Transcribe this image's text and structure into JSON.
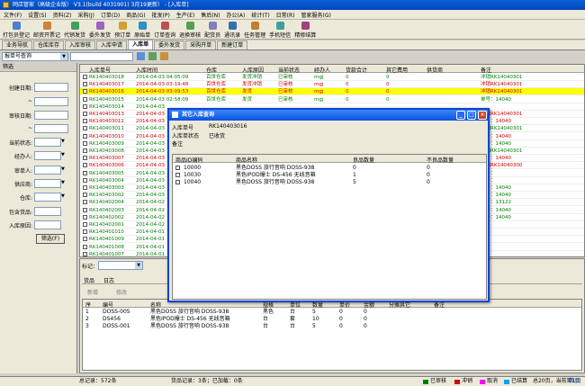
{
  "window": {
    "title": "网店管家（高级企业版） V3.1(build 4031901) 3月19更新） - [入库单]"
  },
  "menu": [
    "文件(F)",
    "设置(S)",
    "资料(Z)",
    "采购(J)",
    "订单(D)",
    "商品(G)",
    "批发(P)",
    "生产(E)",
    "售后(N)",
    "办公(A)",
    "统计(T)",
    "日常(R)",
    "管家服务(G)"
  ],
  "toolbar": [
    "打包员登记",
    "邮资开票记",
    "代销发货",
    "委外发货",
    "预订单",
    "原始单",
    "订单查询",
    "退换审核",
    "配货员",
    "通讯录",
    "任务管理",
    "手机短信",
    "精修结算"
  ],
  "tabs": [
    {
      "label": "业务导航",
      "active": false
    },
    {
      "label": "仓库库存",
      "active": false
    },
    {
      "label": "入库审核",
      "active": false
    },
    {
      "label": "入库申请",
      "active": false
    },
    {
      "label": "入库单",
      "active": true
    },
    {
      "label": "委外发货",
      "active": false
    },
    {
      "label": "采购开单",
      "active": false
    },
    {
      "label": "新建订单",
      "active": false
    }
  ],
  "top_controls": {
    "query_combo": "报单号查询"
  },
  "filter": {
    "header": "筛选",
    "labels": [
      "创建日期:",
      "~",
      "审核日期:",
      "~",
      "当前状态:",
      "经办人:",
      "审单人:",
      "供应商:",
      "仓库:",
      "包含货品:",
      "入库原因:"
    ],
    "button": "筛选(F)"
  },
  "grid": {
    "columns": [
      "入库单号",
      "入库时间",
      "仓库",
      "入库原因",
      "当前状态",
      "经办人",
      "货款合计",
      "其它费用",
      "供货商",
      "备注"
    ],
    "rows": [
      {
        "no": "RK140403018",
        "time": "2014-04-03 04:05:09",
        "wh": "百世仓库",
        "reason": "发货冲销",
        "status": "已审核",
        "op": "mgj",
        "amt": "0",
        "fee": "0",
        "note": "冲销RK14040301",
        "color": "#008000",
        "bg": ""
      },
      {
        "no": "RK140403017",
        "time": "2014-04-03 03:19:48",
        "wh": "百世仓库",
        "reason": "发货冲销",
        "status": "已审核",
        "op": "mgj",
        "amt": "0",
        "fee": "0",
        "note": "冲销RK14040301",
        "color": "#d00000",
        "bg": ""
      },
      {
        "no": "RK140403016",
        "time": "2014-04-03 03:09:53",
        "wh": "百世仓库",
        "reason": "发货",
        "status": "已审核",
        "op": "mgj",
        "amt": "0",
        "fee": "0",
        "note": "冲销RK14040301",
        "color": "#d00000",
        "bg": "#ffff00"
      },
      {
        "no": "RK140403015",
        "time": "2014-04-03 02:58:09",
        "wh": "百世仓库",
        "reason": "发货",
        "status": "已审核",
        "op": "mgj",
        "amt": "0",
        "fee": "0",
        "note": "单号：14040",
        "color": "#008000",
        "bg": ""
      },
      {
        "no": "RK140403014",
        "time": "2014-04-03",
        "wh": "",
        "reason": "",
        "status": "",
        "op": "",
        "amt": "",
        "fee": "",
        "note": "",
        "color": "#008000",
        "bg": ""
      },
      {
        "no": "RK140403013",
        "time": "2014-04-03",
        "wh": "",
        "reason": "",
        "status": "",
        "op": "",
        "amt": "",
        "fee": "",
        "note": "冲销RK14040301",
        "color": "#d00000",
        "bg": ""
      },
      {
        "no": "RK140403012",
        "time": "2014-04-03",
        "wh": "",
        "reason": "",
        "status": "",
        "op": "",
        "amt": "",
        "fee": "",
        "note": "单号：14040",
        "color": "#d00000",
        "bg": ""
      },
      {
        "no": "RK140403011",
        "time": "2014-04-03",
        "wh": "",
        "reason": "",
        "status": "",
        "op": "",
        "amt": "",
        "fee": "",
        "note": "冲销RK14040301",
        "color": "#008000",
        "bg": ""
      },
      {
        "no": "RK140403010",
        "time": "2014-04-03",
        "wh": "",
        "reason": "",
        "status": "",
        "op": "",
        "amt": "",
        "fee": "",
        "note": "单号：14040",
        "color": "#d00000",
        "bg": ""
      },
      {
        "no": "RK140403009",
        "time": "2014-04-03",
        "wh": "",
        "reason": "",
        "status": "",
        "op": "",
        "amt": "",
        "fee": "",
        "note": "单号：14040",
        "color": "#008000",
        "bg": ""
      },
      {
        "no": "RK140403008",
        "time": "2014-04-03",
        "wh": "",
        "reason": "",
        "status": "",
        "op": "",
        "amt": "",
        "fee": "",
        "note": "冲销RK14040301",
        "color": "#008000",
        "bg": ""
      },
      {
        "no": "RK140403007",
        "time": "2014-04-03",
        "wh": "",
        "reason": "",
        "status": "",
        "op": "",
        "amt": "",
        "fee": "",
        "note": "单号：14040",
        "color": "#d00000",
        "bg": ""
      },
      {
        "no": "RK140403006",
        "time": "2014-04-03",
        "wh": "",
        "reason": "",
        "status": "",
        "op": "",
        "amt": "",
        "fee": "",
        "note": "冲销RK14040300",
        "color": "#d00000",
        "bg": ""
      },
      {
        "no": "RK140403005",
        "time": "2014-04-03",
        "wh": "",
        "reason": "",
        "status": "",
        "op": "",
        "amt": "",
        "fee": "",
        "note": "单号：",
        "color": "#008000",
        "bg": ""
      },
      {
        "no": "RK140403004",
        "time": "2014-04-03",
        "wh": "",
        "reason": "",
        "status": "",
        "op": "",
        "amt": "",
        "fee": "",
        "note": "单号：",
        "color": "#008000",
        "bg": ""
      },
      {
        "no": "RK140403003",
        "time": "2014-04-03",
        "wh": "",
        "reason": "",
        "status": "",
        "op": "",
        "amt": "",
        "fee": "",
        "note": "单号：14040",
        "color": "#008000",
        "bg": ""
      },
      {
        "no": "RK140403002",
        "time": "2014-04-03",
        "wh": "",
        "reason": "",
        "status": "",
        "op": "",
        "amt": "",
        "fee": "",
        "note": "单号：14040",
        "color": "#008000",
        "bg": ""
      },
      {
        "no": "RK140402004",
        "time": "2014-04-02",
        "wh": "",
        "reason": "",
        "status": "",
        "op": "",
        "amt": "",
        "fee": "",
        "note": "单号：13122",
        "color": "#008000",
        "bg": ""
      },
      {
        "no": "RK140402003",
        "time": "2014-04-02",
        "wh": "",
        "reason": "",
        "status": "",
        "op": "",
        "amt": "",
        "fee": "",
        "note": "单号：14040",
        "color": "#008000",
        "bg": ""
      },
      {
        "no": "RK140402002",
        "time": "2014-04-02",
        "wh": "",
        "reason": "",
        "status": "",
        "op": "",
        "amt": "",
        "fee": "",
        "note": "单号：14040",
        "color": "#008000",
        "bg": ""
      },
      {
        "no": "RK140402001",
        "time": "2014-04-02",
        "wh": "",
        "reason": "",
        "status": "",
        "op": "",
        "amt": "",
        "fee": "",
        "note": "",
        "color": "#008000",
        "bg": ""
      },
      {
        "no": "RK140401010",
        "time": "2014-04-01",
        "wh": "",
        "reason": "",
        "status": "",
        "op": "",
        "amt": "",
        "fee": "",
        "note": "",
        "color": "#008000",
        "bg": ""
      },
      {
        "no": "RK140401009",
        "time": "2014-04-01",
        "wh": "",
        "reason": "",
        "status": "",
        "op": "",
        "amt": "",
        "fee": "",
        "note": "",
        "color": "#008000",
        "bg": ""
      },
      {
        "no": "RK140401008",
        "time": "2014-04-01",
        "wh": "",
        "reason": "",
        "status": "",
        "op": "",
        "amt": "",
        "fee": "",
        "note": "",
        "color": "#008000",
        "bg": ""
      },
      {
        "no": "RK140401007",
        "time": "2014-04-01",
        "wh": "",
        "reason": "",
        "status": "",
        "op": "",
        "amt": "",
        "fee": "",
        "note": "",
        "color": "#008000",
        "bg": ""
      }
    ]
  },
  "bottom": {
    "tag_label": "标记：",
    "tabs": [
      "货品",
      "日志"
    ],
    "buttons": [
      "新增",
      "修改"
    ],
    "columns": [
      "序",
      "编号",
      "名称",
      "规格",
      "单位",
      "数量",
      "单价",
      "金额",
      "分摊其它",
      "备注"
    ],
    "rows": [
      {
        "seq": "1",
        "code": "DOSS-005",
        "name": "黑色DOSS 旅行音响 DOSS-938",
        "spec": "黑色",
        "unit": "台",
        "qty": "5",
        "price": "0",
        "amt": "0"
      },
      {
        "seq": "2",
        "code": "DS456",
        "name": "黑色IPOD爆士 DS-456 无线音箱",
        "spec": "台",
        "unit": "套",
        "qty": "10",
        "price": "0",
        "amt": "0"
      },
      {
        "seq": "3",
        "code": "DOSS-001",
        "name": "黑色DOSS 旅行音响 DOSS-938",
        "spec": "台",
        "unit": "台",
        "qty": "5",
        "price": "0",
        "amt": "0"
      }
    ]
  },
  "status": {
    "total": "总记录：572条",
    "sub": "货品记录：3条；已加载：0条",
    "legend": [
      {
        "label": "已审核",
        "color": "#008000"
      },
      {
        "label": "冲销",
        "color": "#d00000"
      },
      {
        "label": "取消",
        "color": "#ff00ff"
      },
      {
        "label": "已结算",
        "color": "#00a0ff"
      }
    ],
    "pages": "总20页，当前第1页",
    "first": "首页"
  },
  "dialog": {
    "title": "其它入库查询",
    "fields": [
      {
        "label": "入库单号",
        "value": "RK140403016"
      },
      {
        "label": "入库单状态",
        "value": "已收货"
      },
      {
        "label": "备注",
        "value": ""
      }
    ],
    "columns": [
      "商品ID编码",
      "商品名称",
      "良品数量",
      "不良品数量"
    ],
    "rows": [
      {
        "id": "10000",
        "name": "黑色DOSS 旅行音响 DOSS-938",
        "good": "0",
        "bad": "0"
      },
      {
        "id": "10030",
        "name": "黑色IPOD爆士 DS-456 无线音箱",
        "good": "1",
        "bad": "0"
      },
      {
        "id": "10040",
        "name": "黑色DOSS 旅行音响 DOSS-938",
        "good": "5",
        "bad": "0"
      }
    ]
  }
}
